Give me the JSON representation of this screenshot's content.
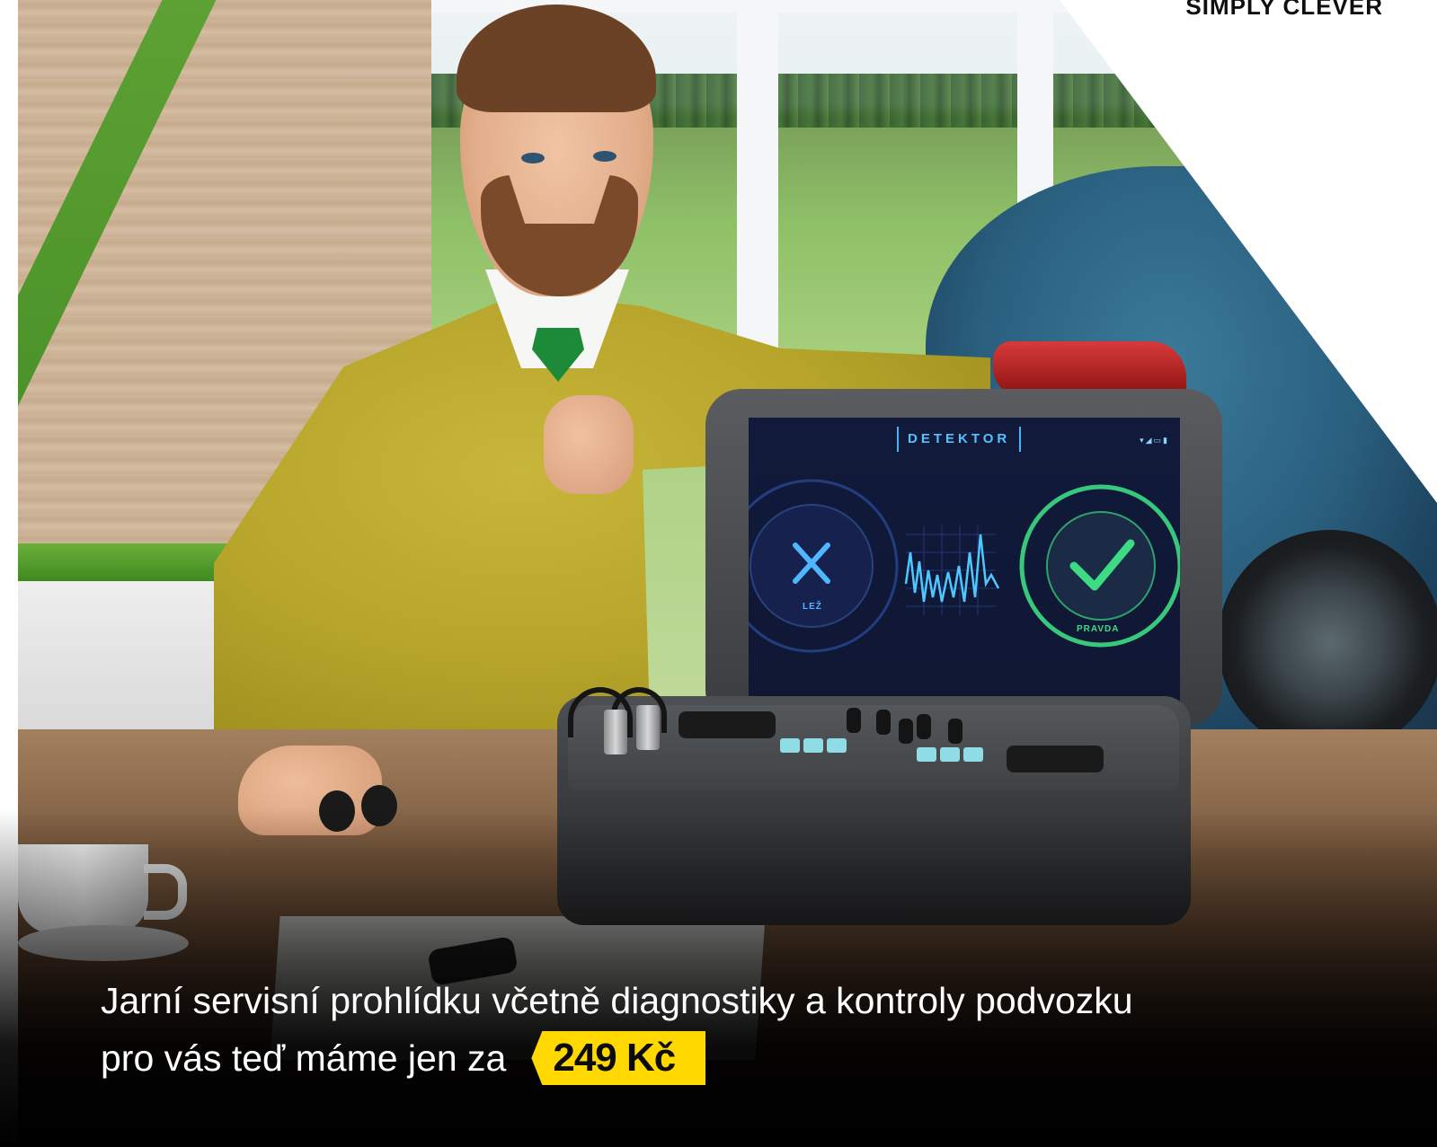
{
  "brand": {
    "tagline": "SIMPLY CLEVER"
  },
  "device": {
    "screen_title": "DETEKTOR",
    "status_icons": "▾◢▭▮",
    "left_gauge_label": "LEŽ",
    "right_gauge_label": "PRAVDA"
  },
  "caption": {
    "line1": "Jarní servisní prohlídku včetně diagnostiky a kontroly podvozku",
    "line2": "pro vás teď máme jen za",
    "price": "249 Kč"
  },
  "colors": {
    "price_badge": "#ffd800",
    "screen_accent_green": "#3ddc84",
    "screen_accent_blue": "#3fb6ff",
    "tie_green": "#1d8a3a"
  }
}
